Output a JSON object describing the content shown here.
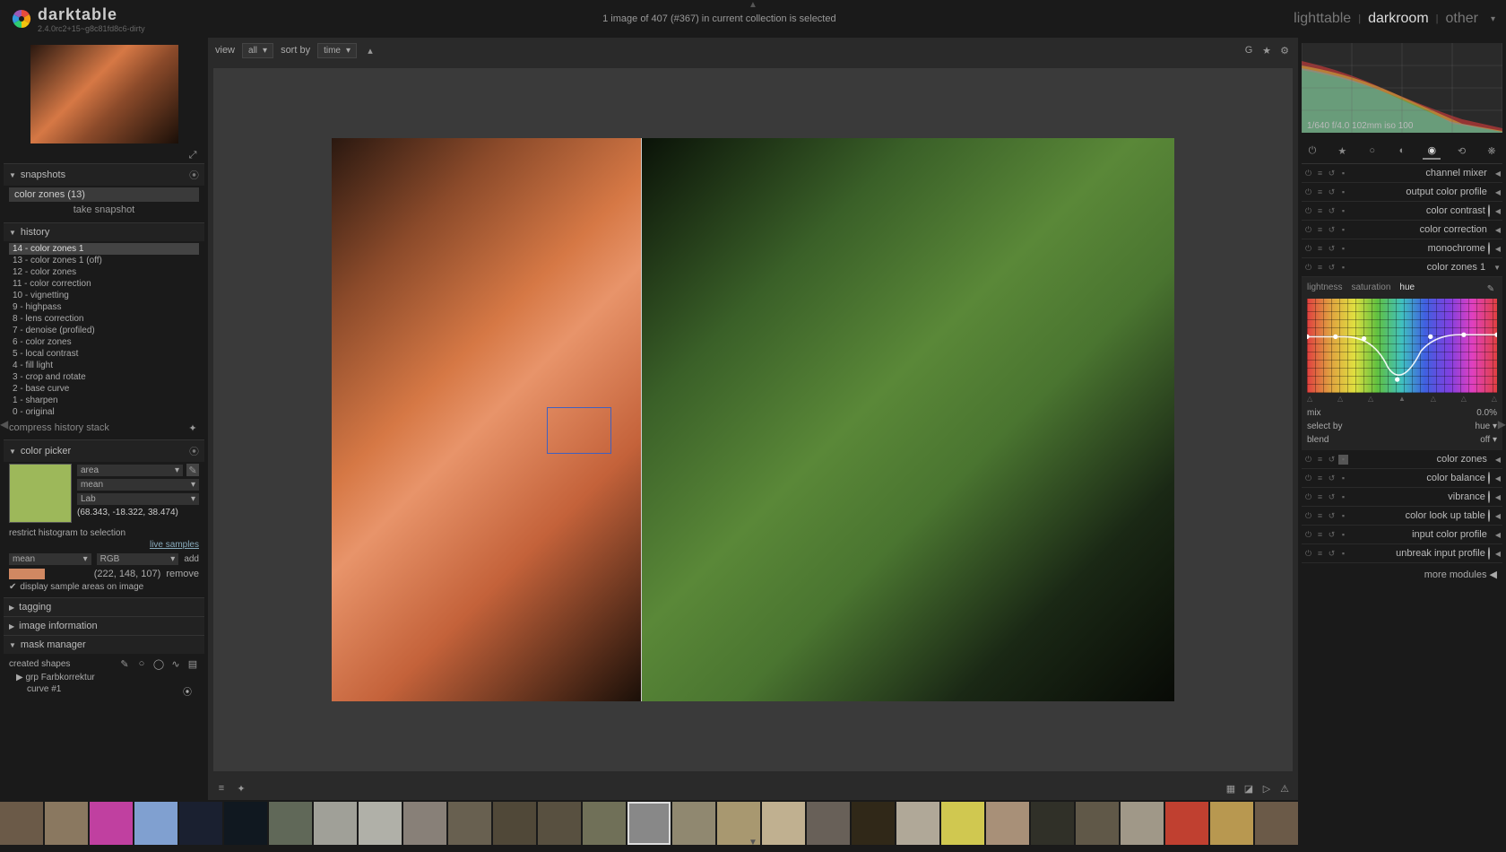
{
  "app": {
    "name": "darktable",
    "version": "2.4.0rc2+15~g8c81fd8c6-dirty"
  },
  "header": {
    "status": "1 image of 407 (#367) in current collection is selected",
    "views": {
      "lighttable": "lighttable",
      "darkroom": "darkroom",
      "other": "other"
    }
  },
  "toolbar": {
    "view_label": "view",
    "view_value": "all",
    "sort_label": "sort by",
    "sort_value": "time"
  },
  "snapshots": {
    "title": "snapshots",
    "item": "color zones (13)",
    "take": "take snapshot"
  },
  "history": {
    "title": "history",
    "items": [
      "14 - color zones 1",
      "13 - color zones 1 (off)",
      "12 - color zones",
      "11 - color correction",
      "10 - vignetting",
      "9 - highpass",
      "8 - lens correction",
      "7 - denoise (profiled)",
      "6 - color zones",
      "5 - local contrast",
      "4 - fill light",
      "3 - crop and rotate",
      "2 - base curve",
      "1 - sharpen",
      "0 - original"
    ],
    "compress": "compress history stack"
  },
  "picker": {
    "title": "color picker",
    "mode": "area",
    "stat": "mean",
    "space": "Lab",
    "lab_value": "(68.343, -18.322, 38.474)",
    "restrict": "restrict histogram to selection",
    "live": "live samples",
    "col1": "mean",
    "col2": "RGB",
    "add": "add",
    "rgb_value": "(222, 148, 107)",
    "remove": "remove",
    "checkbox": "display sample areas on image",
    "swatch_big": "#9db85a",
    "swatch_small": "#d08862"
  },
  "panels": {
    "tagging": "tagging",
    "image_info": "image information",
    "mask_manager": "mask manager"
  },
  "mask": {
    "created": "created shapes",
    "group": "grp Farbkorrektur",
    "curve": "curve #1"
  },
  "histogram_info": "1/640 f/4.0 102mm iso 100",
  "modules": [
    {
      "name": "channel mixer",
      "icon": "rainbow"
    },
    {
      "name": "output color profile",
      "icon": "rainbow"
    },
    {
      "name": "color contrast",
      "icon": "circle"
    },
    {
      "name": "color correction",
      "icon": "rainbow"
    },
    {
      "name": "monochrome",
      "icon": "half"
    },
    {
      "name": "color zones 1",
      "icon": "rainbow",
      "expanded": true
    },
    {
      "name": "color zones",
      "icon": "rainbow"
    },
    {
      "name": "color balance",
      "icon": "circle"
    },
    {
      "name": "vibrance",
      "icon": "circle"
    },
    {
      "name": "color look up table",
      "icon": "circle"
    },
    {
      "name": "input color profile",
      "icon": "rainbow"
    },
    {
      "name": "unbreak input profile",
      "icon": "circle"
    }
  ],
  "colorzones": {
    "tabs": {
      "lightness": "lightness",
      "saturation": "saturation",
      "hue": "hue"
    },
    "mix_label": "mix",
    "mix_value": "0.0%",
    "select_label": "select by",
    "select_value": "hue",
    "blend_label": "blend",
    "blend_value": "off"
  },
  "more_modules": "more modules",
  "filmstrip_count": 29
}
